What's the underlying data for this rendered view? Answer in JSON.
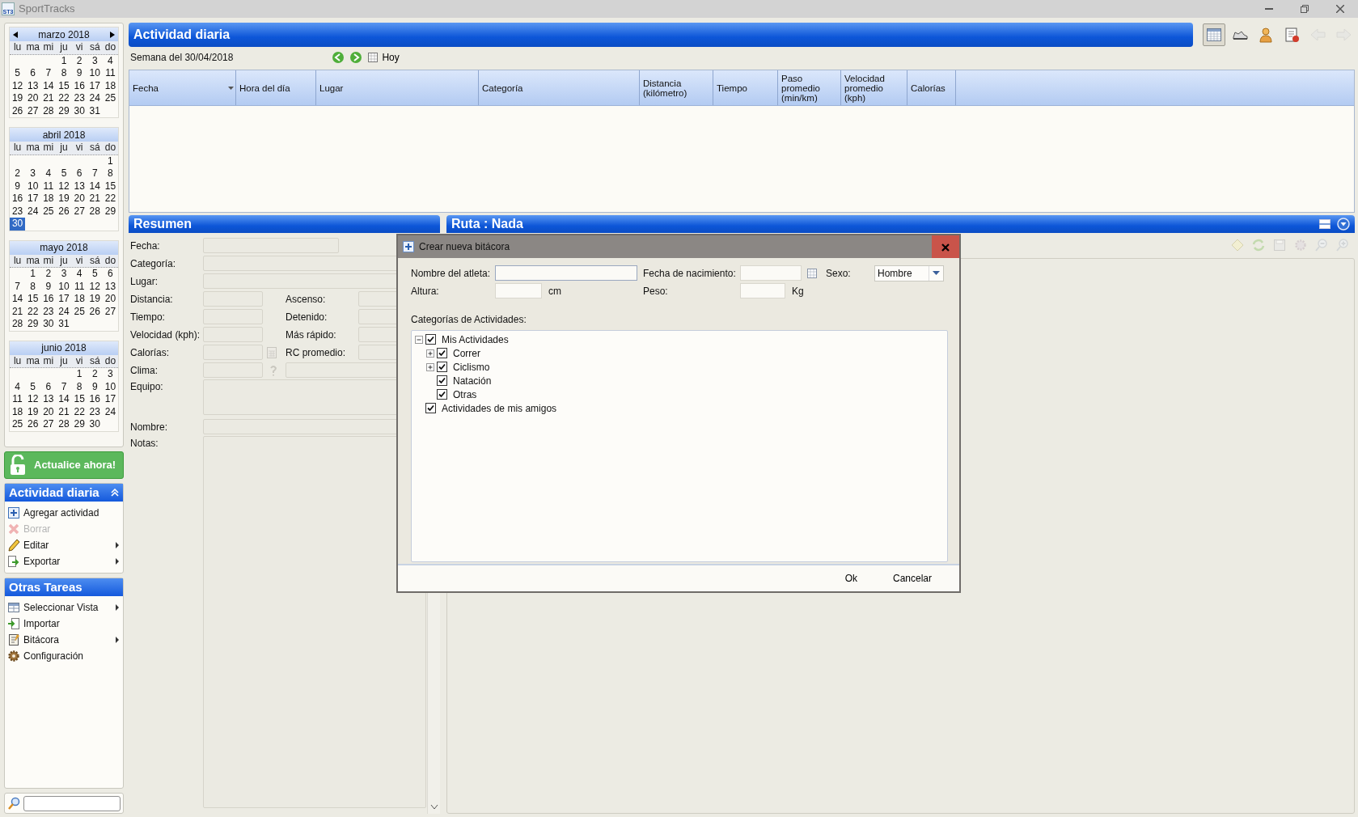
{
  "window": {
    "title": "SportTracks",
    "icon_label": "ST3"
  },
  "calendars": [
    {
      "title": "marzo 2018",
      "nav": true,
      "weekdays": [
        "lu",
        "ma",
        "mi",
        "ju",
        "vi",
        "sá",
        "do"
      ],
      "weeks": [
        [
          {
            "d": "1",
            "selected": false
          },
          {
            "d": "2",
            "selected": false
          },
          {
            "d": "3",
            "selected": false
          },
          {
            "d": "4",
            "selected": false
          }
        ],
        [
          {
            "d": "5",
            "selected": false
          },
          {
            "d": "6",
            "selected": false
          },
          {
            "d": "7",
            "selected": false
          },
          {
            "d": "8",
            "selected": false
          },
          {
            "d": "9",
            "selected": false
          },
          {
            "d": "10",
            "selected": false
          },
          {
            "d": "11",
            "selected": false
          }
        ],
        [
          {
            "d": "12",
            "selected": false
          },
          {
            "d": "13",
            "selected": false
          },
          {
            "d": "14",
            "selected": false
          },
          {
            "d": "15",
            "selected": false
          },
          {
            "d": "16",
            "selected": false
          },
          {
            "d": "17",
            "selected": false
          },
          {
            "d": "18",
            "selected": false
          }
        ],
        [
          {
            "d": "19",
            "selected": false
          },
          {
            "d": "20",
            "selected": false
          },
          {
            "d": "21",
            "selected": false
          },
          {
            "d": "22",
            "selected": false
          },
          {
            "d": "23",
            "selected": false
          },
          {
            "d": "24",
            "selected": false
          },
          {
            "d": "25",
            "selected": false
          }
        ],
        [
          {
            "d": "26",
            "selected": false
          },
          {
            "d": "27",
            "selected": false
          },
          {
            "d": "28",
            "selected": false
          },
          {
            "d": "29",
            "selected": false
          },
          {
            "d": "30",
            "selected": false
          },
          {
            "d": "31",
            "selected": false
          }
        ]
      ]
    },
    {
      "title": "abril 2018",
      "nav": false,
      "weekdays": [
        "lu",
        "ma",
        "mi",
        "ju",
        "vi",
        "sá",
        "do"
      ],
      "weeks": [
        [
          {
            "d": "1",
            "selected": false
          }
        ],
        [
          {
            "d": "2",
            "selected": false
          },
          {
            "d": "3",
            "selected": false
          },
          {
            "d": "4",
            "selected": false
          },
          {
            "d": "5",
            "selected": false
          },
          {
            "d": "6",
            "selected": false
          },
          {
            "d": "7",
            "selected": false
          },
          {
            "d": "8",
            "selected": false
          }
        ],
        [
          {
            "d": "9",
            "selected": false
          },
          {
            "d": "10",
            "selected": false
          },
          {
            "d": "11",
            "selected": false
          },
          {
            "d": "12",
            "selected": false
          },
          {
            "d": "13",
            "selected": false
          },
          {
            "d": "14",
            "selected": false
          },
          {
            "d": "15",
            "selected": false
          }
        ],
        [
          {
            "d": "16",
            "selected": false
          },
          {
            "d": "17",
            "selected": false
          },
          {
            "d": "18",
            "selected": false
          },
          {
            "d": "19",
            "selected": false
          },
          {
            "d": "20",
            "selected": false
          },
          {
            "d": "21",
            "selected": false
          },
          {
            "d": "22",
            "selected": false
          }
        ],
        [
          {
            "d": "23",
            "selected": false
          },
          {
            "d": "24",
            "selected": false
          },
          {
            "d": "25",
            "selected": false
          },
          {
            "d": "26",
            "selected": false
          },
          {
            "d": "27",
            "selected": false
          },
          {
            "d": "28",
            "selected": false
          },
          {
            "d": "29",
            "selected": false
          }
        ],
        [
          {
            "d": "30",
            "selected": true
          }
        ]
      ]
    },
    {
      "title": "mayo 2018",
      "nav": false,
      "weekdays": [
        "lu",
        "ma",
        "mi",
        "ju",
        "vi",
        "sá",
        "do"
      ],
      "weeks": [
        [
          {
            "d": "1",
            "selected": false
          },
          {
            "d": "2",
            "selected": false
          },
          {
            "d": "3",
            "selected": false
          },
          {
            "d": "4",
            "selected": false
          },
          {
            "d": "5",
            "selected": false
          },
          {
            "d": "6",
            "selected": false
          }
        ],
        [
          {
            "d": "7",
            "selected": false
          },
          {
            "d": "8",
            "selected": false
          },
          {
            "d": "9",
            "selected": false
          },
          {
            "d": "10",
            "selected": false
          },
          {
            "d": "11",
            "selected": false
          },
          {
            "d": "12",
            "selected": false
          },
          {
            "d": "13",
            "selected": false
          }
        ],
        [
          {
            "d": "14",
            "selected": false
          },
          {
            "d": "15",
            "selected": false
          },
          {
            "d": "16",
            "selected": false
          },
          {
            "d": "17",
            "selected": false
          },
          {
            "d": "18",
            "selected": false
          },
          {
            "d": "19",
            "selected": false
          },
          {
            "d": "20",
            "selected": false
          }
        ],
        [
          {
            "d": "21",
            "selected": false
          },
          {
            "d": "22",
            "selected": false
          },
          {
            "d": "23",
            "selected": false
          },
          {
            "d": "24",
            "selected": false
          },
          {
            "d": "25",
            "selected": false
          },
          {
            "d": "26",
            "selected": false
          },
          {
            "d": "27",
            "selected": false
          }
        ],
        [
          {
            "d": "28",
            "selected": false
          },
          {
            "d": "29",
            "selected": false
          },
          {
            "d": "30",
            "selected": false
          },
          {
            "d": "31",
            "selected": false
          }
        ]
      ]
    },
    {
      "title": "junio 2018",
      "nav": false,
      "weekdays": [
        "lu",
        "ma",
        "mi",
        "ju",
        "vi",
        "sá",
        "do"
      ],
      "weeks": [
        [
          {
            "d": "1",
            "selected": false
          },
          {
            "d": "2",
            "selected": false
          },
          {
            "d": "3",
            "selected": false
          }
        ],
        [
          {
            "d": "4",
            "selected": false
          },
          {
            "d": "5",
            "selected": false
          },
          {
            "d": "6",
            "selected": false
          },
          {
            "d": "7",
            "selected": false
          },
          {
            "d": "8",
            "selected": false
          },
          {
            "d": "9",
            "selected": false
          },
          {
            "d": "10",
            "selected": false
          }
        ],
        [
          {
            "d": "11",
            "selected": false
          },
          {
            "d": "12",
            "selected": false
          },
          {
            "d": "13",
            "selected": false
          },
          {
            "d": "14",
            "selected": false
          },
          {
            "d": "15",
            "selected": false
          },
          {
            "d": "16",
            "selected": false
          },
          {
            "d": "17",
            "selected": false
          }
        ],
        [
          {
            "d": "18",
            "selected": false
          },
          {
            "d": "19",
            "selected": false
          },
          {
            "d": "20",
            "selected": false
          },
          {
            "d": "21",
            "selected": false
          },
          {
            "d": "22",
            "selected": false
          },
          {
            "d": "23",
            "selected": false
          },
          {
            "d": "24",
            "selected": false
          }
        ],
        [
          {
            "d": "25",
            "selected": false
          },
          {
            "d": "26",
            "selected": false
          },
          {
            "d": "27",
            "selected": false
          },
          {
            "d": "28",
            "selected": false
          },
          {
            "d": "29",
            "selected": false
          },
          {
            "d": "30",
            "selected": false
          }
        ]
      ]
    }
  ],
  "sidebar": {
    "upgrade": "Actualice ahora!",
    "panels": [
      {
        "title": "Actividad diaria",
        "collapsible": true,
        "items": [
          {
            "label": "Agregar actividad",
            "kind": "add",
            "disabled": false,
            "submenu": false
          },
          {
            "label": "Borrar",
            "kind": "delete",
            "disabled": true,
            "submenu": false
          },
          {
            "label": "Editar",
            "kind": "edit",
            "disabled": false,
            "submenu": true
          },
          {
            "label": "Exportar",
            "kind": "export",
            "disabled": false,
            "submenu": true
          }
        ]
      },
      {
        "title": "Otras Tareas",
        "collapsible": false,
        "items": [
          {
            "label": "Seleccionar Vista",
            "kind": "view",
            "disabled": false,
            "submenu": true
          },
          {
            "label": "Importar",
            "kind": "import",
            "disabled": false,
            "submenu": false
          },
          {
            "label": "Bitácora",
            "kind": "logbook",
            "disabled": false,
            "submenu": true
          },
          {
            "label": "Configuración",
            "kind": "settings",
            "disabled": false,
            "submenu": false
          }
        ]
      }
    ]
  },
  "header": {
    "title": "Actividad diaria",
    "tools": [
      {
        "kind": "calendar",
        "selected": true,
        "disabled": false
      },
      {
        "kind": "shoe",
        "selected": false,
        "disabled": false
      },
      {
        "kind": "athlete",
        "selected": false,
        "disabled": false
      },
      {
        "kind": "logbook",
        "selected": false,
        "disabled": false
      },
      {
        "kind": "back",
        "selected": false,
        "disabled": true
      },
      {
        "kind": "forward",
        "selected": false,
        "disabled": true
      }
    ]
  },
  "week": {
    "label": "Semana del 30/04/2018",
    "today": "Hoy"
  },
  "table": {
    "columns": [
      {
        "label": "Fecha",
        "sorted": true
      },
      {
        "label": "Hora del día",
        "sorted": false
      },
      {
        "label": "Lugar",
        "sorted": false
      },
      {
        "label": "Categoría",
        "sorted": false
      },
      {
        "label": "Distancia (kilómetro)",
        "sorted": false
      },
      {
        "label": "Tiempo",
        "sorted": false
      },
      {
        "label": "Paso promedio (min/km)",
        "sorted": false
      },
      {
        "label": "Velocidad promedio (kph)",
        "sorted": false
      },
      {
        "label": "Calorías",
        "sorted": false
      }
    ]
  },
  "summary": {
    "title": "Resumen",
    "rows": [
      {
        "kind": "date",
        "label": "Fecha:"
      },
      {
        "kind": "wide",
        "label": "Categoría:"
      },
      {
        "kind": "wide",
        "label": "Lugar:"
      },
      {
        "kind": "pair",
        "label": "Distancia:",
        "label_2": "Ascenso:"
      },
      {
        "kind": "pair",
        "label": "Tiempo:",
        "label_2": "Detenido:"
      },
      {
        "kind": "pair",
        "label": "Velocidad (kph):",
        "label_2": "Más rápido:"
      },
      {
        "kind": "calc",
        "label": "Calorías:",
        "label_2": "RC promedio:"
      },
      {
        "kind": "weather",
        "label": "Clima:"
      },
      {
        "kind": "tall",
        "label": "Equipo:"
      },
      {
        "kind": "wide",
        "label": "Nombre:"
      },
      {
        "kind": "notes",
        "label": "Notas:"
      }
    ]
  },
  "route": {
    "title": "Ruta : Nada",
    "tools": [
      {
        "kind": "diamond",
        "disabled": true
      },
      {
        "kind": "refresh",
        "disabled": true
      },
      {
        "kind": "save",
        "disabled": true
      },
      {
        "kind": "gear",
        "disabled": true
      },
      {
        "kind": "zoom_out",
        "disabled": true
      },
      {
        "kind": "zoom_in",
        "disabled": true
      }
    ]
  },
  "dialog": {
    "title": "Crear nueva bitácora",
    "athlete_label": "Nombre del atleta:",
    "birth_label": "Fecha de nacimiento:",
    "sex_label": "Sexo:",
    "sex_value": "Hombre",
    "height_label": "Altura:",
    "height_unit": "cm",
    "weight_label": "Peso:",
    "weight_unit": "Kg",
    "categories_label": "Categorías de Actividades:",
    "tree": [
      {
        "label": "Mis Actividades",
        "checked": true,
        "expanded": true,
        "children": [
          {
            "label": "Correr",
            "checked": true,
            "expanded": false
          },
          {
            "label": "Ciclismo",
            "checked": true,
            "expanded": false
          },
          {
            "label": "Natación",
            "checked": true
          },
          {
            "label": "Otras",
            "checked": true
          }
        ]
      },
      {
        "label": "Actividades de mis amigos",
        "checked": true
      }
    ],
    "buttons": [
      "Ok",
      "Cancelar"
    ]
  }
}
